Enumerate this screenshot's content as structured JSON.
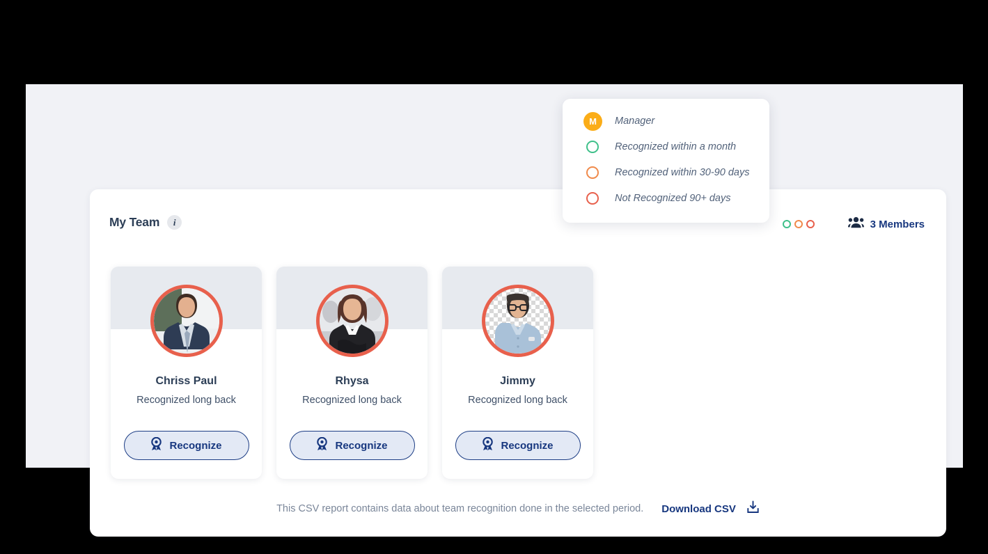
{
  "panel": {
    "title": "My Team",
    "info_icon_glyph": "i",
    "members_count_label": "3 Members",
    "people_icon": "people-group-icon",
    "status_dots": [
      {
        "name": "status-dot-green",
        "color": "#3FC08A"
      },
      {
        "name": "status-dot-orange",
        "color": "#F08A4B"
      },
      {
        "name": "status-dot-red",
        "color": "#E8604C"
      }
    ]
  },
  "legend": {
    "manager_badge_initial": "M",
    "manager_badge_color": "#FBAD18",
    "rows": [
      {
        "label": "Manager",
        "marker": "badge",
        "color": "#FBAD18"
      },
      {
        "label": "Recognized within a month",
        "marker": "ring",
        "color": "#3FC08A"
      },
      {
        "label": "Recognized within 30-90 days",
        "marker": "ring",
        "color": "#F08A4B"
      },
      {
        "label": "Not Recognized 90+ days",
        "marker": "ring",
        "color": "#E8604C"
      }
    ]
  },
  "members": [
    {
      "name": "Chriss Paul",
      "status": "Recognized long back",
      "button_label": "Recognize",
      "avatar": "man-in-navy-suit-photo",
      "ring_color": "#E8604C"
    },
    {
      "name": "Rhysa",
      "status": "Recognized long back",
      "button_label": "Recognize",
      "avatar": "woman-in-black-blazer-photo",
      "ring_color": "#E8604C"
    },
    {
      "name": "Jimmy",
      "status": "Recognized long back",
      "button_label": "Recognize",
      "avatar": "man-with-glasses-blue-shirt-photo",
      "ring_color": "#E8604C"
    }
  ],
  "footer": {
    "note": "This CSV report contains data about team recognition done in the selected period.",
    "download_label": "Download CSV",
    "download_icon": "download-icon"
  },
  "colors": {
    "accent_navy": "#17377F",
    "coral": "#E8604C",
    "amber": "#FBAD18",
    "green": "#3FC08A",
    "orange": "#F08A4B",
    "page_bg": "#F1F2F6",
    "card_banner": "#E7EAEF"
  }
}
